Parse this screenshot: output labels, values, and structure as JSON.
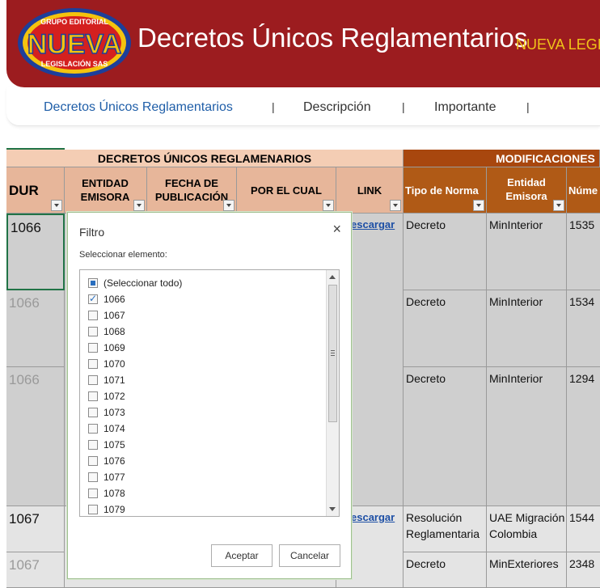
{
  "banner": {
    "logo_line1": "GRUPO EDITORIAL",
    "logo_line2": "NUEVA",
    "logo_line3": "LEGISLACIÓN SAS",
    "title": "Decretos Únicos Reglamentarios",
    "subtitle": "NUEVA LEGIS"
  },
  "nav": {
    "items": [
      {
        "label": "Decretos Únicos Reglamentarios",
        "color": "#1f5ea8"
      },
      {
        "label": "Descripción",
        "color": "#333333"
      },
      {
        "label": "Importante",
        "color": "#333333"
      }
    ],
    "separator": "|"
  },
  "sheet": {
    "group_left": "DECRETOS ÚNICOS REGLAMENARIOS",
    "group_right": "MODIFICACIONES",
    "headers": {
      "dur": "DUR",
      "entidad": "ENTIDAD EMISORA",
      "fecha": "FECHA DE PUBLICACIÓN",
      "porcual": "POR EL CUAL",
      "link": "LINK",
      "tipo": "Tipo de Norma",
      "entidad2": "Entidad Emisora",
      "numero": "Núme"
    },
    "rows": [
      {
        "dur": "1066",
        "link": "escargar",
        "tipo": "Decreto",
        "entidad": "MinInterior",
        "numero": "1535"
      },
      {
        "dur": "1066",
        "tipo": "Decreto",
        "entidad": "MinInterior",
        "numero": "1534"
      },
      {
        "dur": "1066",
        "tipo": "Decreto",
        "entidad": "MinInterior",
        "numero": "1294"
      },
      {
        "dur": "1067",
        "link": "escargar",
        "tipo": "Resolución Reglamentaria",
        "entidad": "UAE Migración Colombia",
        "numero": "1544"
      },
      {
        "dur": "1067",
        "tipo": "Decreto",
        "entidad": "MinExteriores",
        "numero": "2348"
      }
    ]
  },
  "filter_dialog": {
    "title": "Filtro",
    "close": "×",
    "label": "Seleccionar elemento:",
    "items": [
      {
        "label": "(Seleccionar todo)",
        "state": "partial"
      },
      {
        "label": "1066",
        "state": "checked"
      },
      {
        "label": "1067",
        "state": "unchecked"
      },
      {
        "label": "1068",
        "state": "unchecked"
      },
      {
        "label": "1069",
        "state": "unchecked"
      },
      {
        "label": "1070",
        "state": "unchecked"
      },
      {
        "label": "1071",
        "state": "unchecked"
      },
      {
        "label": "1072",
        "state": "unchecked"
      },
      {
        "label": "1073",
        "state": "unchecked"
      },
      {
        "label": "1074",
        "state": "unchecked"
      },
      {
        "label": "1075",
        "state": "unchecked"
      },
      {
        "label": "1076",
        "state": "unchecked"
      },
      {
        "label": "1077",
        "state": "unchecked"
      },
      {
        "label": "1078",
        "state": "unchecked"
      },
      {
        "label": "1079",
        "state": "unchecked"
      }
    ],
    "ok": "Aceptar",
    "cancel": "Cancelar"
  },
  "colors": {
    "banner": "#9c1c1f",
    "accent_yellow": "#f0c419",
    "header_left": "#f4cdb4",
    "header_right": "#a8470e",
    "link": "#1d4fa5"
  }
}
